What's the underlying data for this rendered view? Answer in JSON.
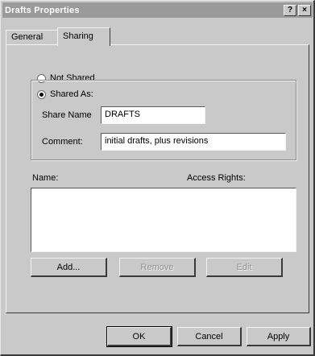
{
  "window": {
    "title": "Drafts Properties",
    "help_button": "?",
    "close_button": "×"
  },
  "tabs": [
    {
      "label": "General"
    },
    {
      "label": "Sharing"
    }
  ],
  "sharing": {
    "not_shared_label": "Not Shared",
    "shared_as_label": "Shared As:",
    "selected_option": "Shared As:",
    "share_name_label": "Share Name",
    "share_name_value": "DRAFTS",
    "comment_label": "Comment:",
    "comment_value": "initial drafts, plus revisions",
    "permissions": {
      "name_header": "Name:",
      "access_rights_header": "Access Rights:",
      "entries": []
    },
    "add_button": "Add...",
    "remove_button": "Remove",
    "edit_button": "Edit"
  },
  "footer": {
    "ok_button": "OK",
    "cancel_button": "Cancel",
    "apply_button": "Apply"
  }
}
